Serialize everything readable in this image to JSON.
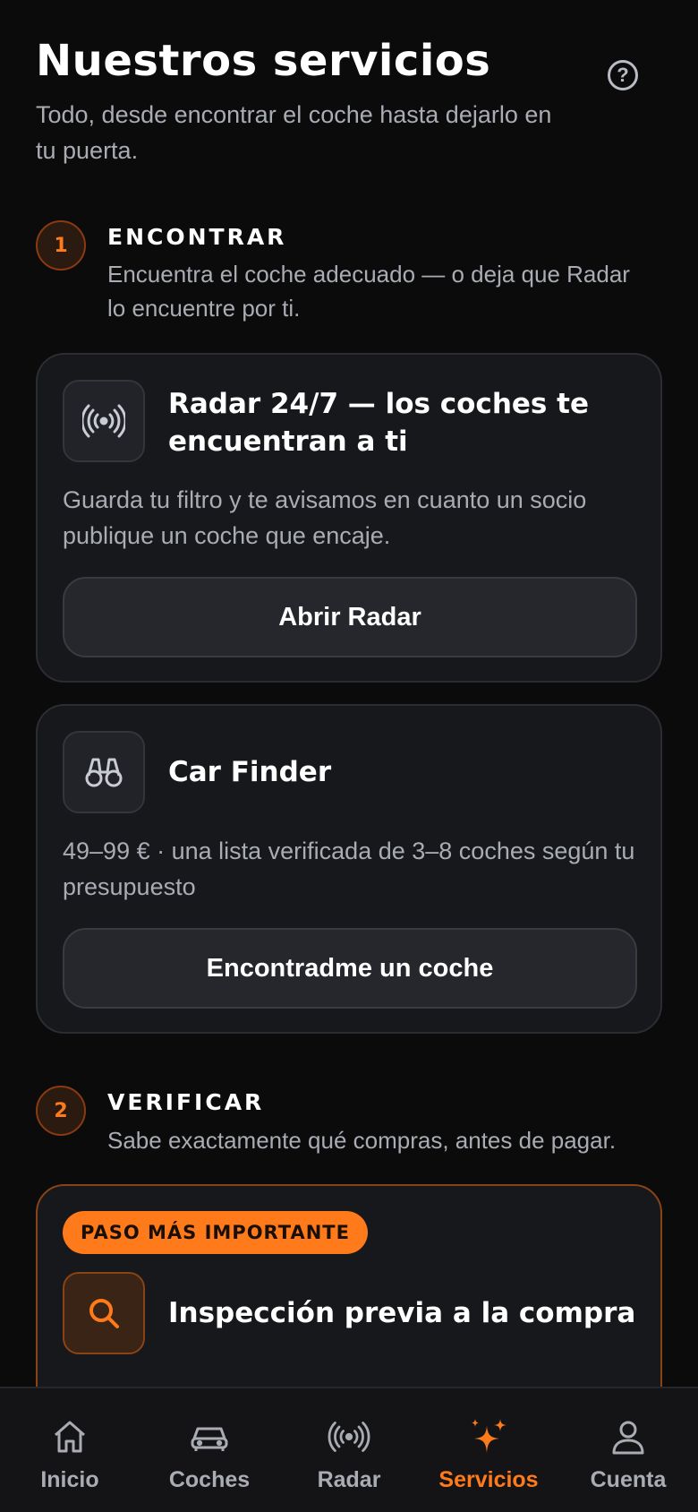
{
  "header": {
    "title": "Nuestros servicios",
    "subtitle": "Todo, desde encontrar el coche hasta dejarlo en tu puerta.",
    "help_icon": "question-circle-icon"
  },
  "steps": [
    {
      "number": "1",
      "title": "ENCONTRAR",
      "description": "Encuentra el coche adecuado — o deja que Radar lo encuentre por ti.",
      "cards": [
        {
          "icon": "radar-broadcast-icon",
          "title": "Radar 24/7 — los coches te encuentran a ti",
          "description": "Guarda tu filtro y te avisamos en cuanto un socio publique un coche que encaje.",
          "button": "Abrir Radar"
        },
        {
          "icon": "binoculars-icon",
          "title": "Car Finder",
          "description": "49–99 € · una lista verificada de 3–8 coches según tu presupuesto",
          "button": "Encontradme un coche"
        }
      ]
    },
    {
      "number": "2",
      "title": "VERIFICAR",
      "description": "Sabe exactamente qué compras, antes de pagar.",
      "cards": [
        {
          "badge": "PASO MÁS IMPORTANTE",
          "icon": "search-icon",
          "title": "Inspección previa a la compra"
        }
      ]
    }
  ],
  "bottom_nav": [
    {
      "label": "Inicio",
      "icon": "home-icon",
      "active": false
    },
    {
      "label": "Coches",
      "icon": "car-icon",
      "active": false
    },
    {
      "label": "Radar",
      "icon": "radar-broadcast-icon",
      "active": false
    },
    {
      "label": "Servicios",
      "icon": "sparkles-icon",
      "active": true
    },
    {
      "label": "Cuenta",
      "icon": "user-icon",
      "active": false
    }
  ],
  "colors": {
    "background": "#0b0b0c",
    "card": "#17181c",
    "accent": "#ff7a1a",
    "text_muted": "#a9acb3"
  }
}
